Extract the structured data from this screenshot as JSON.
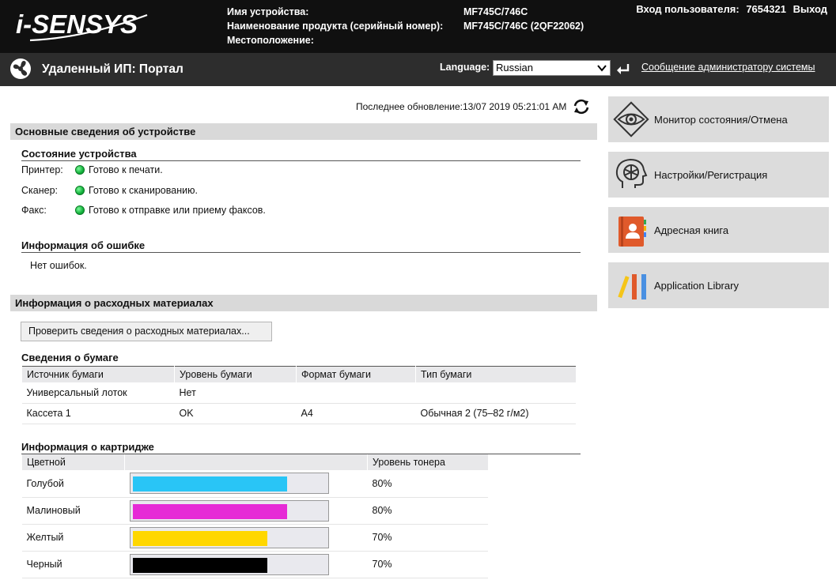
{
  "header": {
    "logo_text": "i-SENSYS",
    "device_name_label": "Имя устройства:",
    "device_name_value": "MF745C/746C",
    "product_label": "Наименование продукта (серийный номер):",
    "product_value": "MF745C/746C (2QF22062)",
    "location_label": "Местоположение:",
    "location_value": "",
    "login_label": "Вход пользователя:",
    "login_value": "7654321",
    "logout": "Выход"
  },
  "titlebar": {
    "title": "Удаленный ИП: Портал",
    "language_label": "Language:",
    "language_value": "Russian",
    "admin_message": "Сообщение администратору системы"
  },
  "main": {
    "last_update": "Последнее обновление:13/07 2019 05:21:01 AM",
    "basic_info_title": "Основные сведения об устройстве",
    "device_status_title": "Состояние устройства",
    "statuses": [
      {
        "label": "Принтер:",
        "value": "Готово к печати."
      },
      {
        "label": "Сканер:",
        "value": "Готово к сканированию."
      },
      {
        "label": "Факс:",
        "value": "Готово к отправке или приему факсов."
      }
    ],
    "error_title": "Информация об ошибке",
    "error_value": "Нет ошибок.",
    "consumables_title": "Информация о расходных материалах",
    "check_button": "Проверить сведения о расходных материалах...",
    "paper_title": "Сведения о бумаге",
    "paper_headers": [
      "Источник бумаги",
      "Уровень бумаги",
      "Формат бумаги",
      "Тип бумаги"
    ],
    "paper_rows": [
      [
        "Универсальный лоток",
        "Нет",
        "",
        ""
      ],
      [
        "Кассета 1",
        "OK",
        "A4",
        "Обычная 2 (75–82 г/м2)"
      ]
    ],
    "cartridge_title": "Информация о картридже",
    "cartridge_headers": [
      "Цветной",
      "",
      "Уровень тонера"
    ],
    "cartridges": [
      {
        "name": "Голубой",
        "level": 0.8,
        "level_text": "80%",
        "color": "#29c5f6"
      },
      {
        "name": "Малиновый",
        "level": 0.8,
        "level_text": "80%",
        "color": "#e62ad6"
      },
      {
        "name": "Желтый",
        "level": 0.7,
        "level_text": "70%",
        "color": "#ffd700"
      },
      {
        "name": "Черный",
        "level": 0.7,
        "level_text": "70%",
        "color": "#000000"
      }
    ]
  },
  "sidebar": {
    "items": [
      {
        "label": "Монитор состояния/Отмена",
        "icon": "eye-icon"
      },
      {
        "label": "Настройки/Регистрация",
        "icon": "settings-head-icon"
      },
      {
        "label": "Адресная книга",
        "icon": "address-book-icon"
      },
      {
        "label": "Application Library",
        "icon": "application-library-icon"
      }
    ]
  }
}
